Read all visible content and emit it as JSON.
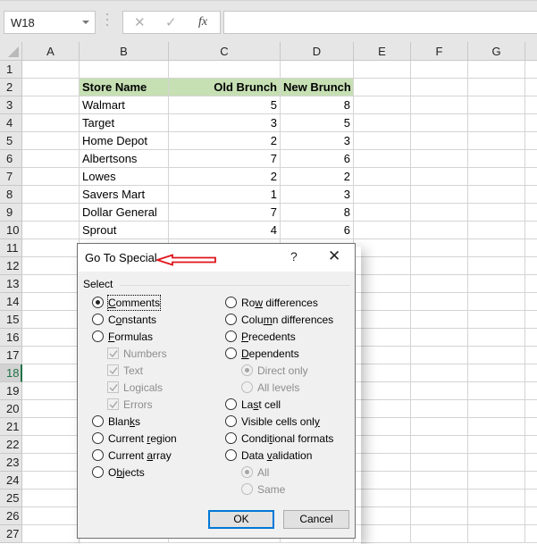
{
  "formula_bar": {
    "name_box": "W18",
    "cancel_icon": "✕",
    "enter_icon": "✓",
    "function_icon": "fx",
    "formula_value": ""
  },
  "sheet": {
    "columns": [
      "A",
      "B",
      "C",
      "D",
      "E",
      "F",
      "G"
    ],
    "rows": [
      "1",
      "2",
      "3",
      "4",
      "5",
      "6",
      "7",
      "8",
      "9",
      "10",
      "11",
      "12",
      "13",
      "14",
      "15",
      "16",
      "17",
      "18",
      "19",
      "20",
      "21",
      "22",
      "23",
      "24",
      "25",
      "26",
      "27"
    ],
    "selected_row": "18",
    "header_fill": "#c6e0b4",
    "table": {
      "headers": [
        "Store Name",
        "Old Brunch",
        "New Brunch"
      ],
      "rows": [
        [
          "Walmart",
          "5",
          "8"
        ],
        [
          "Target",
          "3",
          "5"
        ],
        [
          "Home Depot",
          "2",
          "3"
        ],
        [
          "Albertsons",
          "7",
          "6"
        ],
        [
          "Lowes",
          "2",
          "2"
        ],
        [
          "Savers Mart",
          "1",
          "3"
        ],
        [
          "Dollar General",
          "7",
          "8"
        ],
        [
          "Sprout",
          "4",
          "6"
        ]
      ]
    }
  },
  "dialog": {
    "title": "Go To Special",
    "help": "?",
    "close": "✕",
    "annotation_arrow_color": "#e0151b",
    "group_label": "Select",
    "left_options": [
      {
        "pre": "",
        "u": "C",
        "post": "omments",
        "selected": true,
        "focused": true
      },
      {
        "pre": "C",
        "u": "o",
        "post": "nstants",
        "selected": false
      },
      {
        "pre": "",
        "u": "F",
        "post": "ormulas",
        "selected": false
      },
      {
        "pre": "Blan",
        "u": "k",
        "post": "s",
        "selected": false
      },
      {
        "pre": "Current ",
        "u": "r",
        "post": "egion",
        "selected": false
      },
      {
        "pre": "Current ",
        "u": "a",
        "post": "rray",
        "selected": false
      },
      {
        "pre": "O",
        "u": "b",
        "post": "jects",
        "selected": false
      }
    ],
    "formula_suboptions": [
      {
        "label": "Numbers",
        "checked": true
      },
      {
        "label": "Text",
        "checked": true
      },
      {
        "label": "Logicals",
        "checked": true
      },
      {
        "label": "Errors",
        "checked": true
      }
    ],
    "right_options": [
      {
        "pre": "Ro",
        "u": "w",
        "post": " differences",
        "selected": false
      },
      {
        "pre": "Colu",
        "u": "m",
        "post": "n differences",
        "selected": false
      },
      {
        "pre": "",
        "u": "P",
        "post": "recedents",
        "selected": false
      },
      {
        "pre": "",
        "u": "D",
        "post": "ependents",
        "selected": false
      },
      {
        "pre": "La",
        "u": "s",
        "post": "t cell",
        "selected": false
      },
      {
        "pre": "Visible cells onl",
        "u": "y",
        "post": "",
        "selected": false
      },
      {
        "pre": "Condi",
        "u": "t",
        "post": "ional formats",
        "selected": false
      },
      {
        "pre": "Data ",
        "u": "v",
        "post": "alidation",
        "selected": false
      }
    ],
    "dependents_suboptions": [
      {
        "label": "Direct only",
        "selected": true
      },
      {
        "label": "All levels",
        "selected": false
      }
    ],
    "validation_suboptions": [
      {
        "label": "All",
        "selected": true
      },
      {
        "label": "Same",
        "selected": false
      }
    ],
    "ok_label": "OK",
    "cancel_label": "Cancel"
  }
}
